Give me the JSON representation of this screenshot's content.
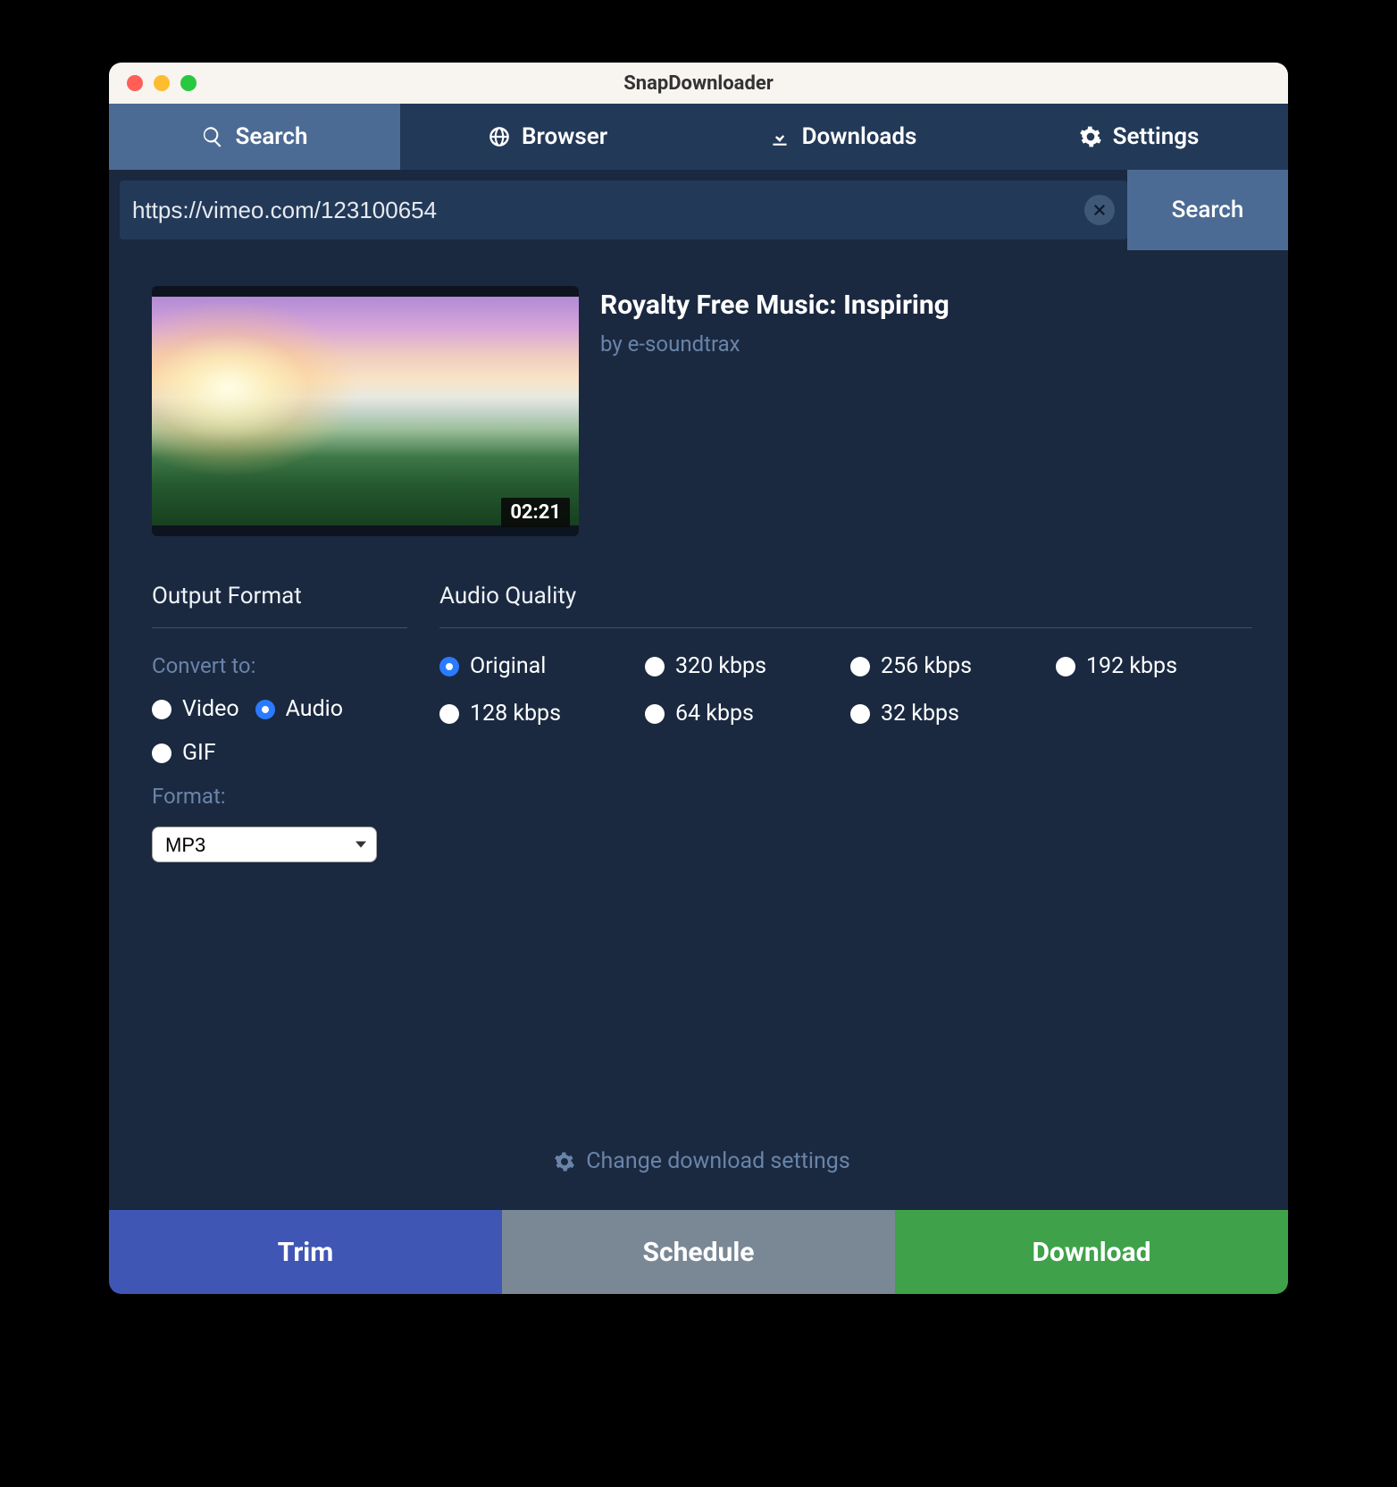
{
  "window": {
    "title": "SnapDownloader"
  },
  "tabs": {
    "search": "Search",
    "browser": "Browser",
    "downloads": "Downloads",
    "settings": "Settings"
  },
  "search": {
    "url_value": "https://vimeo.com/123100654",
    "button": "Search"
  },
  "video": {
    "title": "Royalty Free Music: Inspiring",
    "author": "by e-soundtrax",
    "duration": "02:21"
  },
  "output": {
    "section_title": "Output Format",
    "convert_label": "Convert to:",
    "options": {
      "video": "Video",
      "audio": "Audio",
      "gif": "GIF"
    },
    "selected": "audio",
    "format_label": "Format:",
    "format_value": "MP3"
  },
  "quality": {
    "section_title": "Audio Quality",
    "options": [
      "Original",
      "320 kbps",
      "256 kbps",
      "192 kbps",
      "128 kbps",
      "64 kbps",
      "32 kbps"
    ],
    "selected": "Original"
  },
  "change_settings": "Change download settings",
  "actions": {
    "trim": "Trim",
    "schedule": "Schedule",
    "download": "Download"
  }
}
